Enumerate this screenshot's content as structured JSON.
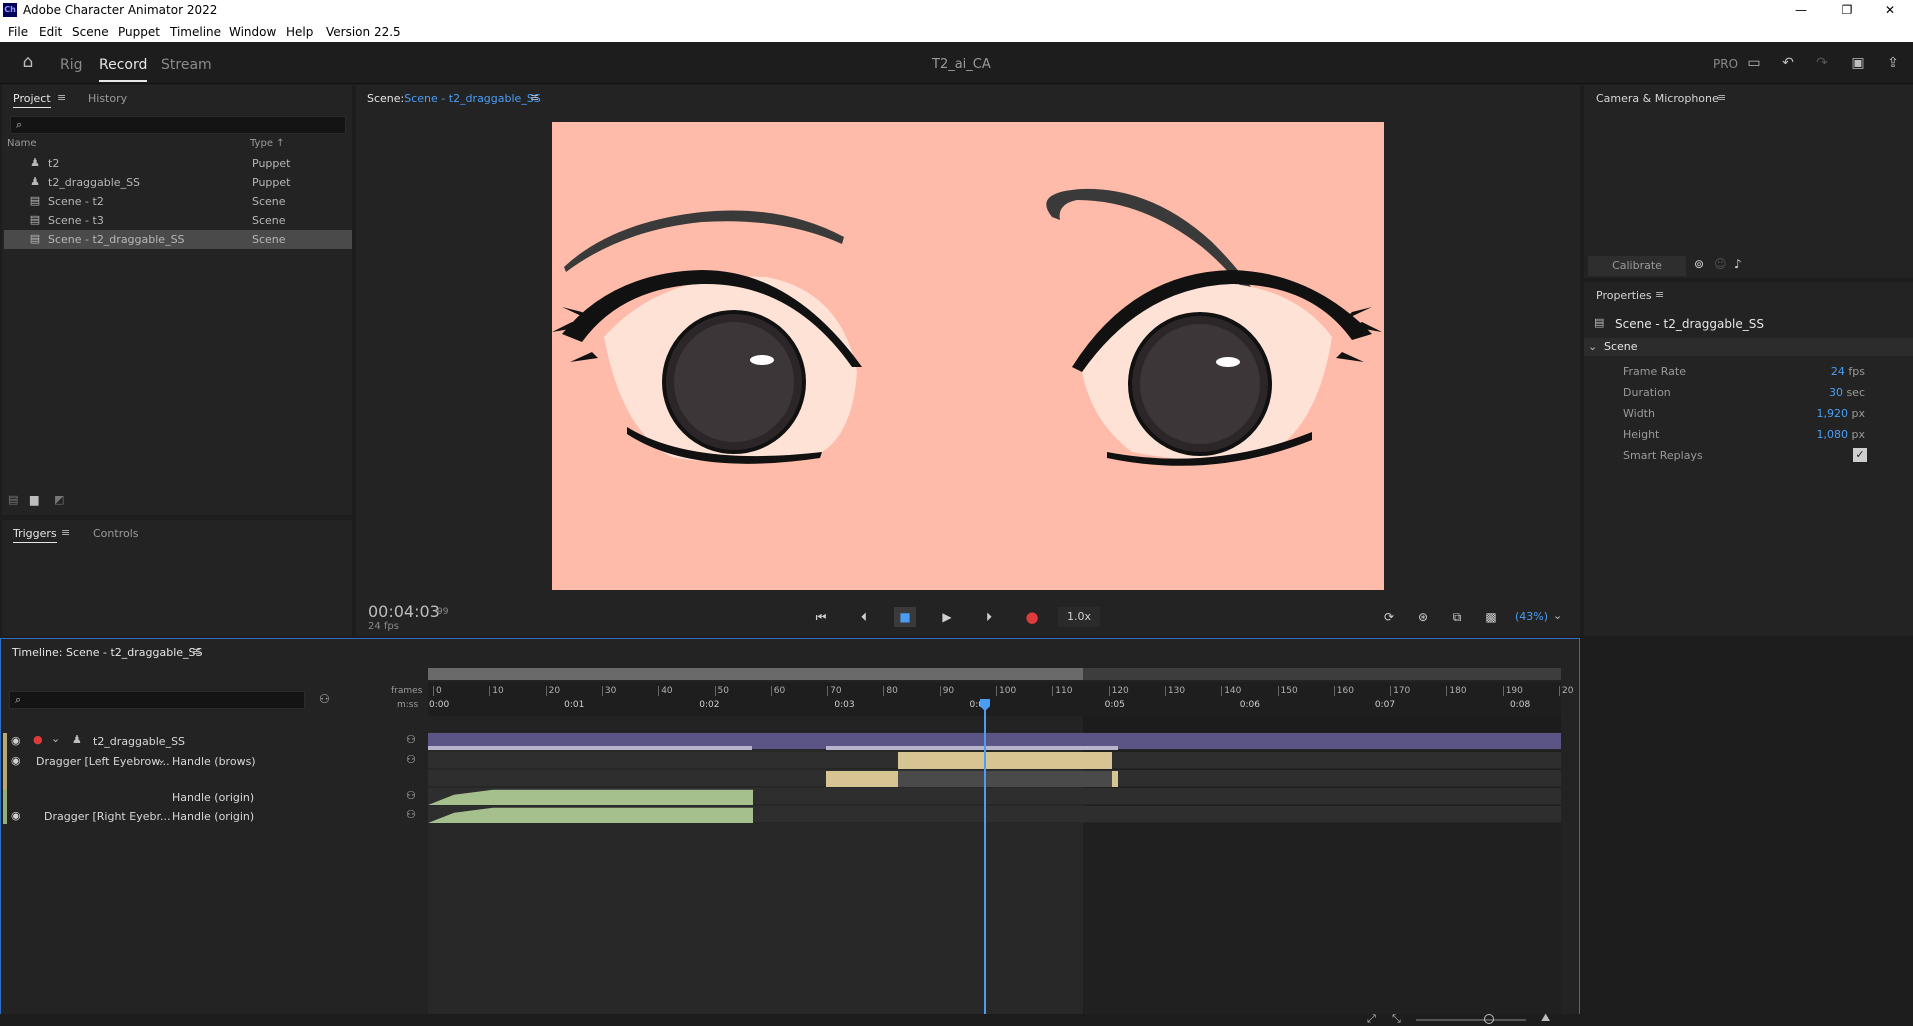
{
  "window": {
    "app_icon": "Ch",
    "title": "Adobe Character Animator 2022",
    "minimize": "—",
    "maximize": "❐",
    "close": "✕"
  },
  "menu": [
    "File",
    "Edit",
    "Scene",
    "Puppet",
    "Timeline",
    "Window",
    "Help",
    "Version 22.5"
  ],
  "header": {
    "tabs": [
      "Rig",
      "Record",
      "Stream"
    ],
    "active_tab": "Record",
    "project_title": "T2_ai_CA",
    "pro_label": "PRO"
  },
  "project_panel": {
    "tabs": [
      "Project",
      "History"
    ],
    "columns": {
      "name": "Name",
      "type": "Type"
    },
    "items": [
      {
        "icon": "puppet-icon",
        "name": "t2",
        "type": "Puppet"
      },
      {
        "icon": "puppet-icon",
        "name": "t2_draggable_SS",
        "type": "Puppet"
      },
      {
        "icon": "scene-icon",
        "name": "Scene - t2",
        "type": "Scene"
      },
      {
        "icon": "scene-icon",
        "name": "Scene - t3",
        "type": "Scene"
      },
      {
        "icon": "scene-icon",
        "name": "Scene - t2_draggable_SS",
        "type": "Scene",
        "selected": true
      }
    ]
  },
  "triggers_panel": {
    "tabs": [
      "Triggers",
      "Controls"
    ]
  },
  "scene_panel": {
    "label": "Scene:",
    "scene_name": "Scene - t2_draggable_SS",
    "timecode": "00:04:03",
    "frame": "99",
    "fps": "24 fps",
    "speed": "1.0x",
    "zoom": "(43%)"
  },
  "camera_panel": {
    "title": "Camera & Microphone",
    "calibrate": "Calibrate"
  },
  "properties_panel": {
    "title": "Properties",
    "item": "Scene - t2_draggable_SS",
    "section": "Scene",
    "rows": [
      {
        "label": "Frame Rate",
        "value": "24",
        "unit": "fps"
      },
      {
        "label": "Duration",
        "value": "30",
        "unit": "sec"
      },
      {
        "label": "Width",
        "value": "1,920",
        "unit": "px"
      },
      {
        "label": "Height",
        "value": "1,080",
        "unit": "px"
      },
      {
        "label": "Smart Replays",
        "value": "",
        "unit": ""
      }
    ],
    "smart_replays_checked": true
  },
  "timeline": {
    "title": "Timeline: Scene - t2_draggable_SS",
    "ruler_frames_label": "frames",
    "ruler_time_label": "m:ss",
    "frame_ticks": [
      "0",
      "10",
      "20",
      "30",
      "40",
      "50",
      "60",
      "70",
      "80",
      "90",
      "100",
      "110",
      "120",
      "130",
      "140",
      "150",
      "160",
      "170",
      "180",
      "190",
      "20"
    ],
    "time_ticks": [
      "0:00",
      "0:01",
      "0:02",
      "0:03",
      "0:04",
      "0:05",
      "0:06",
      "0:07",
      "0:08"
    ],
    "playhead_frame": 99,
    "rows": [
      {
        "name": "t2_draggable_SS",
        "sub": ""
      },
      {
        "name": "Dragger [Left Eyebrow...",
        "sub": "Handle (brows)"
      },
      {
        "name": "",
        "sub": "Handle (origin)"
      },
      {
        "name": "Dragger [Right Eyebr...",
        "sub": "Handle (origin)"
      }
    ]
  },
  "colors": {
    "accent": "#4b9df4",
    "record": "#e03a3a",
    "canvas_bg": "#ffbba9",
    "take_purple": "#5b5585",
    "take_tan": "#d6c592",
    "take_green": "#a5c08c"
  }
}
